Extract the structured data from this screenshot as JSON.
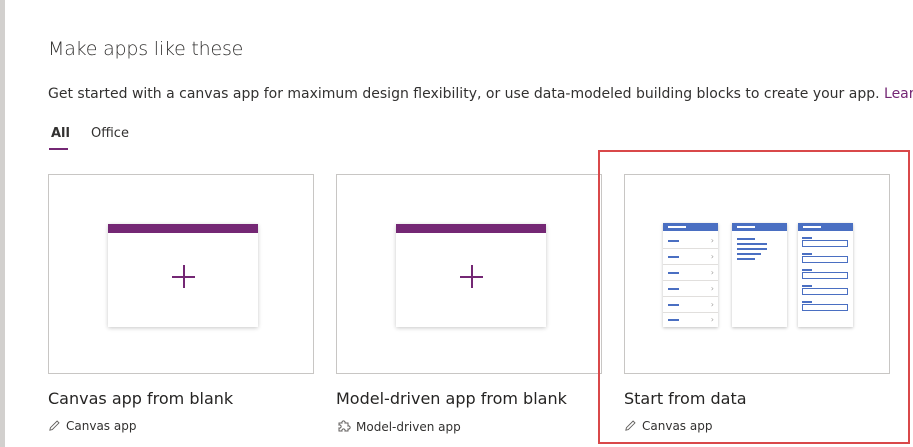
{
  "section": {
    "heading": "Make apps like these",
    "description": "Get started with a canvas app for maximum design flexibility, or use data-modeled building blocks to create your app.",
    "learn_more": "Lear"
  },
  "tabs": [
    {
      "label": "All",
      "active": true
    },
    {
      "label": "Office",
      "active": false
    }
  ],
  "cards": [
    {
      "title": "Canvas app from blank",
      "type": "Canvas app",
      "icon": "pencil-icon"
    },
    {
      "title": "Model-driven app from blank",
      "type": "Model-driven app",
      "icon": "puzzle-icon"
    },
    {
      "title": "Start from data",
      "type": "Canvas app",
      "icon": "pencil-icon"
    }
  ],
  "colors": {
    "accent": "#742774",
    "data_blue": "#4a6fc2",
    "highlight": "#d9484a"
  }
}
